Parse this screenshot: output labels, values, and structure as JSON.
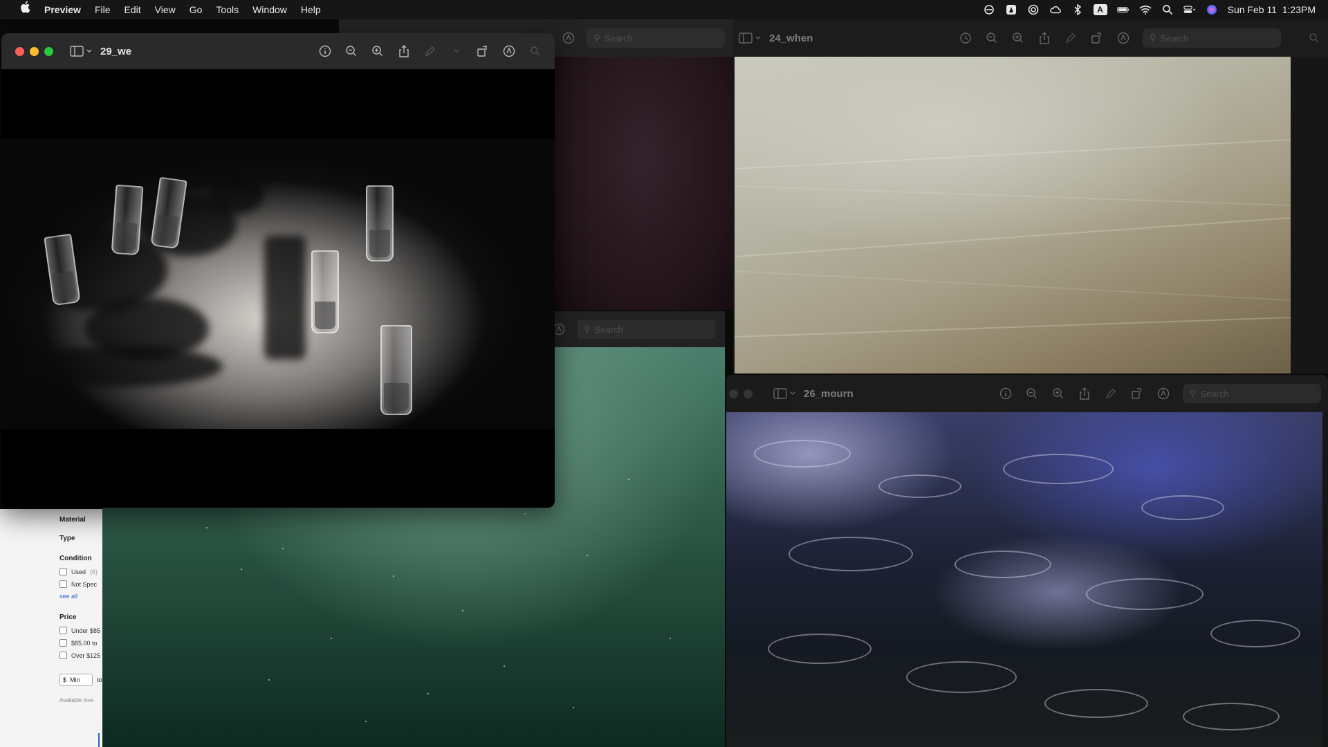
{
  "menubar": {
    "app": "Preview",
    "items": [
      "File",
      "Edit",
      "View",
      "Go",
      "Tools",
      "Window",
      "Help"
    ],
    "clock": "Sun Feb 11  1:23PM",
    "status_icons": [
      "creative-cloud-icon",
      "acrobat-icon",
      "sync-icon",
      "cloud-icon",
      "bluetooth-icon",
      "input-source-icon",
      "battery-icon",
      "wifi-icon",
      "spotlight-icon",
      "control-center-icon",
      "siri-icon"
    ],
    "input_source_letter": "A"
  },
  "windows": {
    "front": {
      "title": "29_we"
    },
    "top_right": {
      "title": "24_when",
      "search_placeholder": "Search"
    },
    "bottom_right": {
      "title": "26_mourn",
      "search_placeholder": "Search"
    },
    "back_top": {
      "search_placeholder": "Search"
    },
    "back_middle": {
      "search_placeholder": "Search"
    }
  },
  "shop": {
    "material_heading": "Material",
    "type_heading": "Type",
    "condition_heading": "Condition",
    "condition_options": [
      "Used",
      "Not Spec"
    ],
    "condition_used_count": "(6)",
    "see_all": "see all",
    "price_heading": "Price",
    "price_options": [
      "Under $85",
      "$85.00 to",
      "Over $125"
    ],
    "min_placeholder": "$  Min",
    "to_label": "to",
    "available_label": "Available inve"
  },
  "colors": {
    "close": "#ff5f57",
    "minimize": "#febc2e",
    "zoom": "#28c840"
  }
}
